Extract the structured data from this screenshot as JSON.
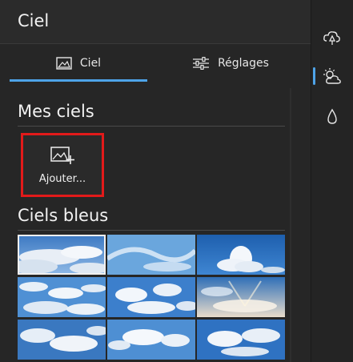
{
  "panel": {
    "title": "Ciel",
    "tabs": [
      {
        "label": "Ciel",
        "icon": "image-icon",
        "active": true
      },
      {
        "label": "Réglages",
        "icon": "sliders-icon",
        "active": false
      }
    ]
  },
  "my_skies": {
    "title": "Mes ciels",
    "add_label": "Ajouter..."
  },
  "blue_skies": {
    "title": "Ciels bleus",
    "thumbnails": [
      {
        "name": "sky-1",
        "selected": true
      },
      {
        "name": "sky-2",
        "selected": false
      },
      {
        "name": "sky-3",
        "selected": false
      },
      {
        "name": "sky-4",
        "selected": false
      },
      {
        "name": "sky-5",
        "selected": false
      },
      {
        "name": "sky-6",
        "selected": false
      },
      {
        "name": "sky-7",
        "selected": false
      },
      {
        "name": "sky-8",
        "selected": false
      },
      {
        "name": "sky-9",
        "selected": false
      }
    ]
  },
  "rail": {
    "items": [
      {
        "icon": "cloud-tree-icon",
        "active": false
      },
      {
        "icon": "sun-cloud-icon",
        "active": true
      },
      {
        "icon": "water-drop-icon",
        "active": false
      }
    ]
  },
  "colors": {
    "accent": "#4ea3e8",
    "highlight_border": "#e21a1a"
  }
}
